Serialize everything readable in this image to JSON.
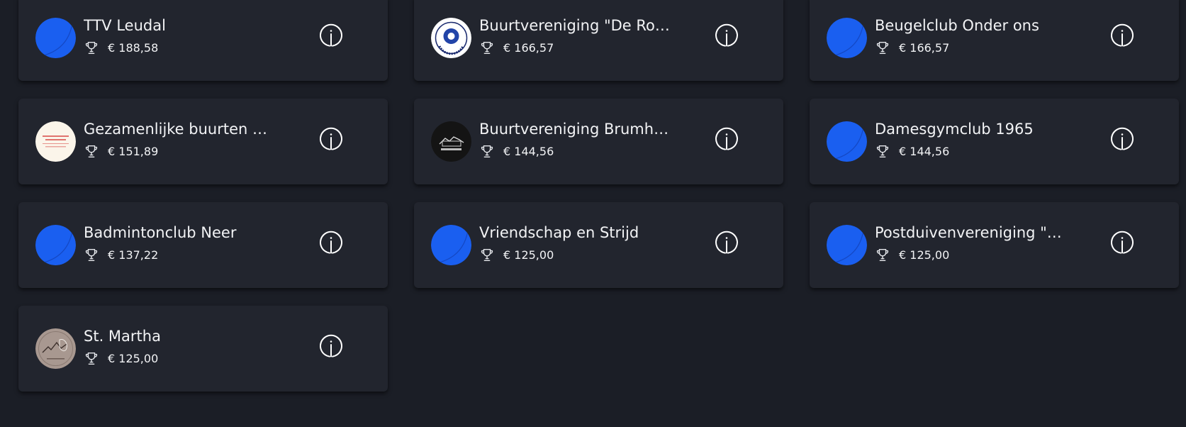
{
  "colors": {
    "background": "#1b1e26",
    "card": "#22252e",
    "text": "#f2f3f5",
    "default_logo": "#1a5ff0"
  },
  "clubs": [
    {
      "name": "TTV Leudal",
      "amount": "€ 188,58",
      "logo": "default-blue-logo"
    },
    {
      "name": "Buurtvereniging \"De Rotonde\"",
      "amount": "€ 166,57",
      "logo": "de-rotonde-logo"
    },
    {
      "name": "Beugelclub Onder ons",
      "amount": "€ 166,57",
      "logo": "default-blue-logo"
    },
    {
      "name": "Gezamenlijke buurten Neer",
      "amount": "€ 151,89",
      "logo": "gezamenlijke-buurten-logo"
    },
    {
      "name": "Buurtvereniging Brumholt",
      "amount": "€ 144,56",
      "logo": "brumholt-logo"
    },
    {
      "name": "Damesgymclub 1965",
      "amount": "€ 144,56",
      "logo": "default-blue-logo"
    },
    {
      "name": "Badmintonclub Neer",
      "amount": "€ 137,22",
      "logo": "default-blue-logo"
    },
    {
      "name": "Vriendschap en Strijd",
      "amount": "€ 125,00",
      "logo": "default-blue-logo"
    },
    {
      "name": "Postduivenvereniging \"T...",
      "amount": "€ 125,00",
      "logo": "default-blue-logo"
    },
    {
      "name": "St. Martha",
      "amount": "€ 125,00",
      "logo": "st-martha-logo"
    }
  ],
  "icons": {
    "trophy": "trophy-icon",
    "info": "info-icon"
  }
}
